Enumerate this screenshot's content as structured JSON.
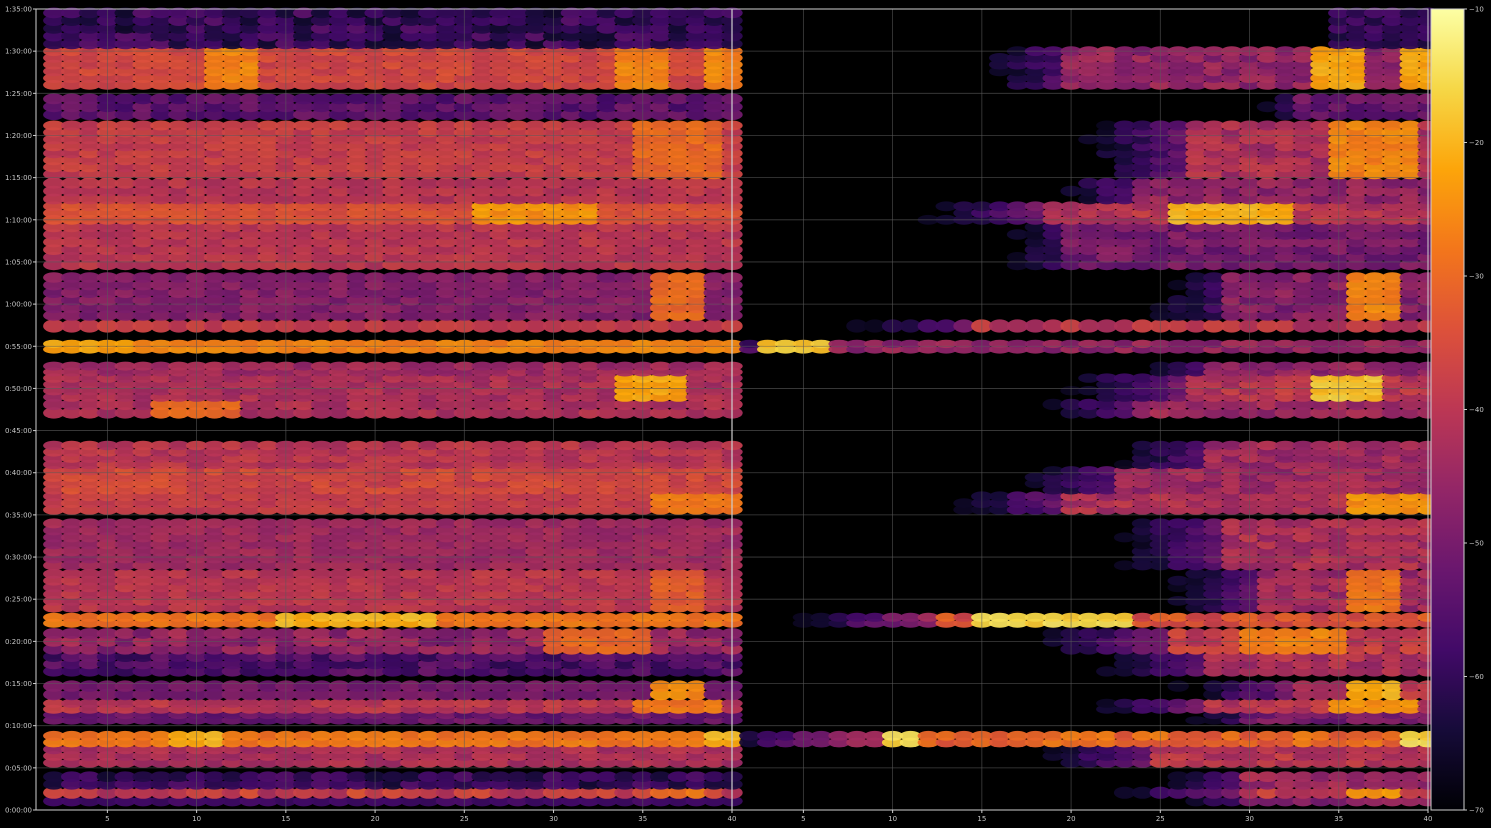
{
  "chart_data": {
    "type": "heatmap",
    "title": "",
    "xlabel": "",
    "ylabel": "",
    "grid": true,
    "colormap": "inferno",
    "colors": {
      "background": "#000000",
      "grid": "#5a5a5a",
      "axis": "#cfcfcf",
      "tick_text": "#c8c8c8"
    },
    "panels": [
      {
        "name": "left",
        "xlim": [
          1,
          40
        ],
        "x_ticks": [
          5,
          10,
          15,
          20,
          25,
          30,
          35,
          40
        ],
        "x_tick_labels": [
          "5",
          "10",
          "15",
          "20",
          "25",
          "30",
          "35",
          "40"
        ]
      },
      {
        "name": "right",
        "xlim": [
          1,
          40
        ],
        "x_ticks": [
          5,
          10,
          15,
          20,
          25,
          30,
          35,
          40
        ],
        "x_tick_labels": [
          "5",
          "10",
          "15",
          "20",
          "25",
          "30",
          "35",
          "40"
        ]
      }
    ],
    "y_axis": {
      "unit": "time",
      "range_minutes": [
        0,
        95
      ],
      "ticks_minutes": [
        0,
        5,
        10,
        15,
        20,
        25,
        30,
        35,
        40,
        45,
        50,
        55,
        60,
        65,
        70,
        75,
        80,
        85,
        90,
        95
      ],
      "tick_labels": [
        "0:00:00",
        "0:05:00",
        "0:10:00",
        "0:15:00",
        "0:20:00",
        "0:25:00",
        "0:30:00",
        "0:35:00",
        "0:40:00",
        "0:45:00",
        "0:50:00",
        "0:55:00",
        "1:00:00",
        "1:05:00",
        "1:10:00",
        "1:15:00",
        "1:20:00",
        "1:25:00",
        "1:30:00",
        "1:35:00"
      ]
    },
    "colorbar": {
      "range": [
        -70,
        -10
      ],
      "ticks": [
        -70,
        -60,
        -50,
        -40,
        -30,
        -20,
        -10
      ],
      "tick_labels": [
        "−70",
        "−60",
        "−50",
        "−40",
        "−30",
        "−20",
        "−10"
      ]
    },
    "bands": [
      {
        "t_start": 0.6,
        "t_end": 1.5,
        "left": -58,
        "left_slope": 3,
        "right_start": 30,
        "right": -48,
        "note": "dim"
      },
      {
        "t_start": 1.5,
        "t_end": 2.6,
        "left": -38,
        "left_slope": 10,
        "right_start": 30,
        "right": -38,
        "peak_x": [
          37
        ],
        "peak_val": -28
      },
      {
        "t_start": 2.6,
        "t_end": 4.4,
        "left": -60,
        "left_slope": 10,
        "right_start": 30,
        "right": -44
      },
      {
        "t_start": 5.2,
        "t_end": 7.6,
        "left": -42,
        "left_slope": 6,
        "right_start": 25,
        "right": -40
      },
      {
        "t_start": 7.6,
        "t_end": 9.2,
        "left": -28,
        "left_slope": 4,
        "right_start": 10,
        "right": -30,
        "peak_x": [
          10,
          40
        ],
        "peak_val": -20
      },
      {
        "t_start": 10.3,
        "t_end": 11.6,
        "left": -52,
        "left_slope": 6,
        "right_start": 30,
        "right": -50
      },
      {
        "t_start": 11.6,
        "t_end": 13.0,
        "left": -40,
        "left_slope": 6,
        "right_start": 28,
        "right": -40,
        "peak_x": [
          36,
          38
        ],
        "peak_val": -28
      },
      {
        "t_start": 13.2,
        "t_end": 15.2,
        "left": -50,
        "left_slope": 4,
        "right_start": 33,
        "right": -40,
        "peak_x": [
          37
        ],
        "peak_val": -25
      },
      {
        "t_start": 16.0,
        "t_end": 18.6,
        "left": -56,
        "left_slope": 10,
        "right_start": 28,
        "right": -42
      },
      {
        "t_start": 18.6,
        "t_end": 21.4,
        "left": -46,
        "left_slope": 10,
        "right_start": 26,
        "right": -38,
        "peak_x": [
          31,
          34
        ],
        "peak_val": -30
      },
      {
        "t_start": 21.8,
        "t_end": 23.2,
        "left": -28,
        "left_slope": 4,
        "right_start": 13,
        "right": -34,
        "peak_x": [
          16,
          18,
          20,
          22
        ],
        "peak_val": -20
      },
      {
        "t_start": 23.6,
        "t_end": 28.4,
        "left": -40,
        "left_slope": 5,
        "right_start": 31,
        "right": -44,
        "peak_x": [
          37
        ],
        "peak_val": -32
      },
      {
        "t_start": 28.6,
        "t_end": 34.4,
        "left": -44,
        "left_slope": 5,
        "right_start": 29,
        "right": -42
      },
      {
        "t_start": 35.2,
        "t_end": 37.6,
        "left": -38,
        "left_slope": 4,
        "right_start": 20,
        "right": -42,
        "peak_x": [
          37,
          40
        ],
        "peak_val": -28
      },
      {
        "t_start": 37.6,
        "t_end": 40.6,
        "left": -36,
        "left_slope": 6,
        "right_start": 23,
        "right": -44
      },
      {
        "t_start": 40.6,
        "t_end": 43.6,
        "left": -40,
        "left_slope": 6,
        "right_start": 28,
        "right": -44
      },
      {
        "t_start": 46.6,
        "t_end": 48.6,
        "left": -42,
        "left_slope": 6,
        "right_start": 24,
        "right": -44,
        "peak_x": [
          9,
          11
        ],
        "peak_val": -30
      },
      {
        "t_start": 48.6,
        "t_end": 51.6,
        "left": -42,
        "left_slope": 6,
        "right_start": 27,
        "right": -40,
        "peak_x": [
          35,
          36
        ],
        "peak_val": -22
      },
      {
        "t_start": 51.6,
        "t_end": 53.0,
        "left": -44,
        "left_slope": 6,
        "right_start": 28,
        "right": -46
      },
      {
        "t_start": 54.3,
        "t_end": 55.6,
        "left": -26,
        "left_slope": 4,
        "right_start": 3,
        "right": -46,
        "peak_x": [
          3,
          5
        ],
        "peak_val": -22
      },
      {
        "t_start": 56.8,
        "t_end": 58.0,
        "left": -38,
        "left_slope": 4,
        "right_start": 15,
        "right": -40
      },
      {
        "t_start": 58.2,
        "t_end": 63.6,
        "left": -48,
        "left_slope": 6,
        "right_start": 29,
        "right": -48,
        "peak_x": [
          37
        ],
        "peak_val": -30
      },
      {
        "t_start": 64.2,
        "t_end": 69.6,
        "left": -40,
        "left_slope": 5,
        "right_start": 20,
        "right": -50
      },
      {
        "t_start": 69.6,
        "t_end": 72.0,
        "left": -34,
        "left_slope": 4,
        "right_start": 19,
        "right": -40,
        "peak_x": [
          27,
          30,
          31
        ],
        "peak_val": -24
      },
      {
        "t_start": 72.0,
        "t_end": 74.8,
        "left": -40,
        "left_slope": 5,
        "right_start": 24,
        "right": -46
      },
      {
        "t_start": 75.0,
        "t_end": 81.6,
        "left": -38,
        "left_slope": 5,
        "right_start": 27,
        "right": -42,
        "peak_x": [
          36,
          38
        ],
        "peak_val": -30
      },
      {
        "t_start": 82.0,
        "t_end": 84.8,
        "left": -54,
        "left_slope": 8,
        "right_start": 33,
        "right": -52
      },
      {
        "t_start": 85.6,
        "t_end": 90.4,
        "left": -36,
        "left_slope": 5,
        "right_start": 20,
        "right": -46,
        "peak_x": [
          12,
          35,
          40
        ],
        "peak_val": -26
      },
      {
        "t_start": 90.4,
        "t_end": 95.0,
        "left": -60,
        "left_slope": 12,
        "right_start": 35,
        "right": -60
      }
    ]
  }
}
